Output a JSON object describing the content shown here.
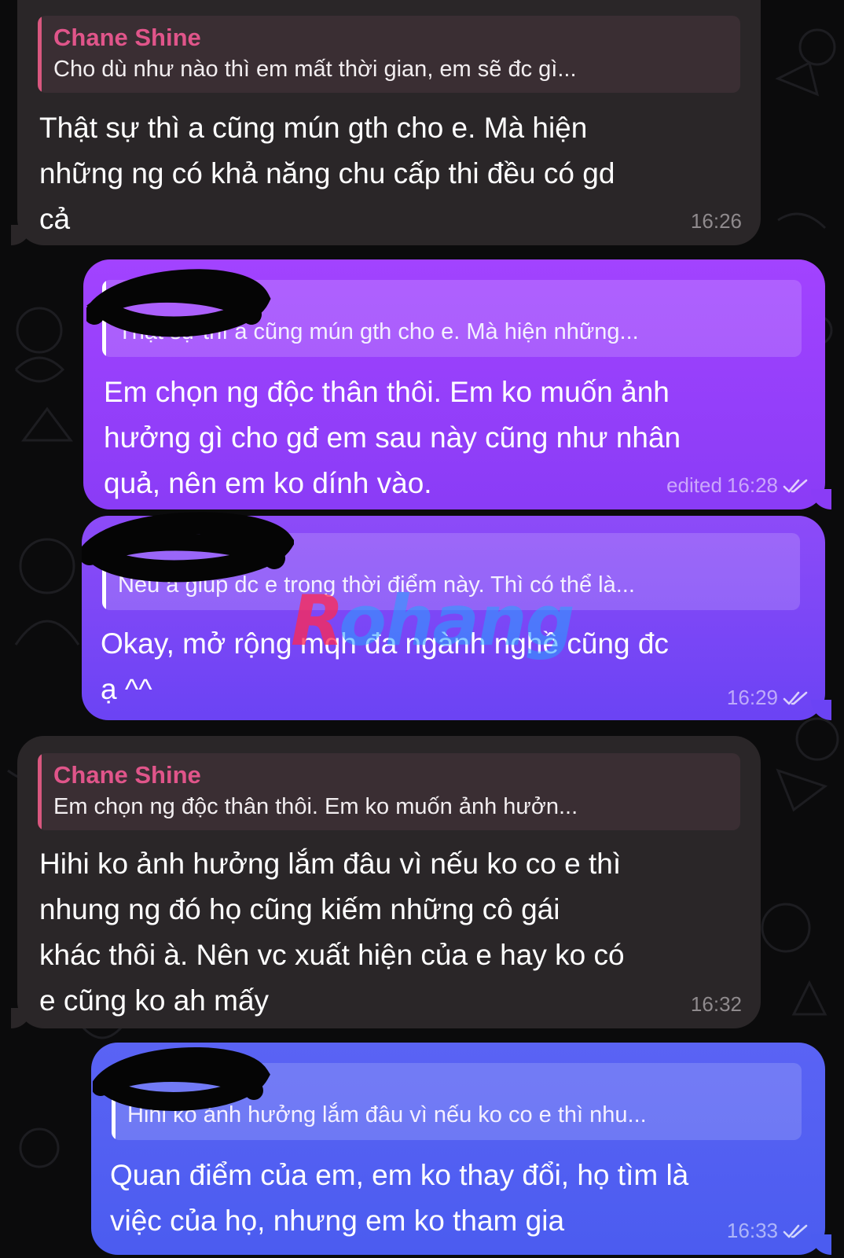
{
  "messages": [
    {
      "direction": "incoming",
      "reply": {
        "name": "Chane Shine",
        "text": "Cho dù như nào thì em mất thời gian, em sẽ đc gì..."
      },
      "lines": [
        "Thật sự thì a cũng mún gth cho e. Mà hiện",
        "những ng có khả năng chu cấp thi đều có gd",
        "cả"
      ],
      "time": "16:26"
    },
    {
      "direction": "outgoing",
      "reply": {
        "name": "",
        "text": "Thật sự thì a cũng mún gth cho e. Mà hiện những..."
      },
      "lines": [
        "Em chọn ng độc thân thôi. Em ko muốn ảnh",
        "hưởng gì cho gđ em sau này cũng như nhân",
        "quả, nên em ko dính vào."
      ],
      "edited_label": "edited",
      "time": "16:28",
      "status": "read"
    },
    {
      "direction": "outgoing",
      "reply": {
        "name": "",
        "text": "Nếu a giúp dc e trong thời điểm này. Thì có thể là..."
      },
      "lines": [
        "Okay, mở rộng mqh đa ngành nghề cũng đc",
        "ạ ^^"
      ],
      "time": "16:29",
      "status": "read"
    },
    {
      "direction": "incoming",
      "reply": {
        "name": "Chane Shine",
        "text": "Em chọn ng độc thân thôi. Em ko muốn ảnh hưởn..."
      },
      "lines": [
        "Hihi ko ảnh hưởng lắm đâu vì nếu ko co e thì",
        "nhung ng đó họ cũng kiếm những cô gái",
        "khác thôi à. Nên vc xuất hiện của e hay ko có",
        "e cũng ko ah mấy"
      ],
      "time": "16:32"
    },
    {
      "direction": "outgoing",
      "reply": {
        "name": "",
        "text": "Hihi ko ảnh hưởng lắm đâu vì nếu ko co e thì nhu..."
      },
      "lines": [
        "Quan điểm của em, em ko thay đổi, họ tìm là",
        "việc của họ, nhưng em ko tham gia"
      ],
      "time": "16:33",
      "status": "read"
    }
  ],
  "watermark": {
    "first": "R",
    "rest": "ohang"
  },
  "colors": {
    "background": "#0b0b0c",
    "incoming_bubble": "#2a2628",
    "reply_name": "#e0558a",
    "outgoing_top": "#a243ff",
    "outgoing_bottom": "#4b5cf0"
  },
  "icons": [
    "double-check-icon",
    "redaction-scribble"
  ]
}
